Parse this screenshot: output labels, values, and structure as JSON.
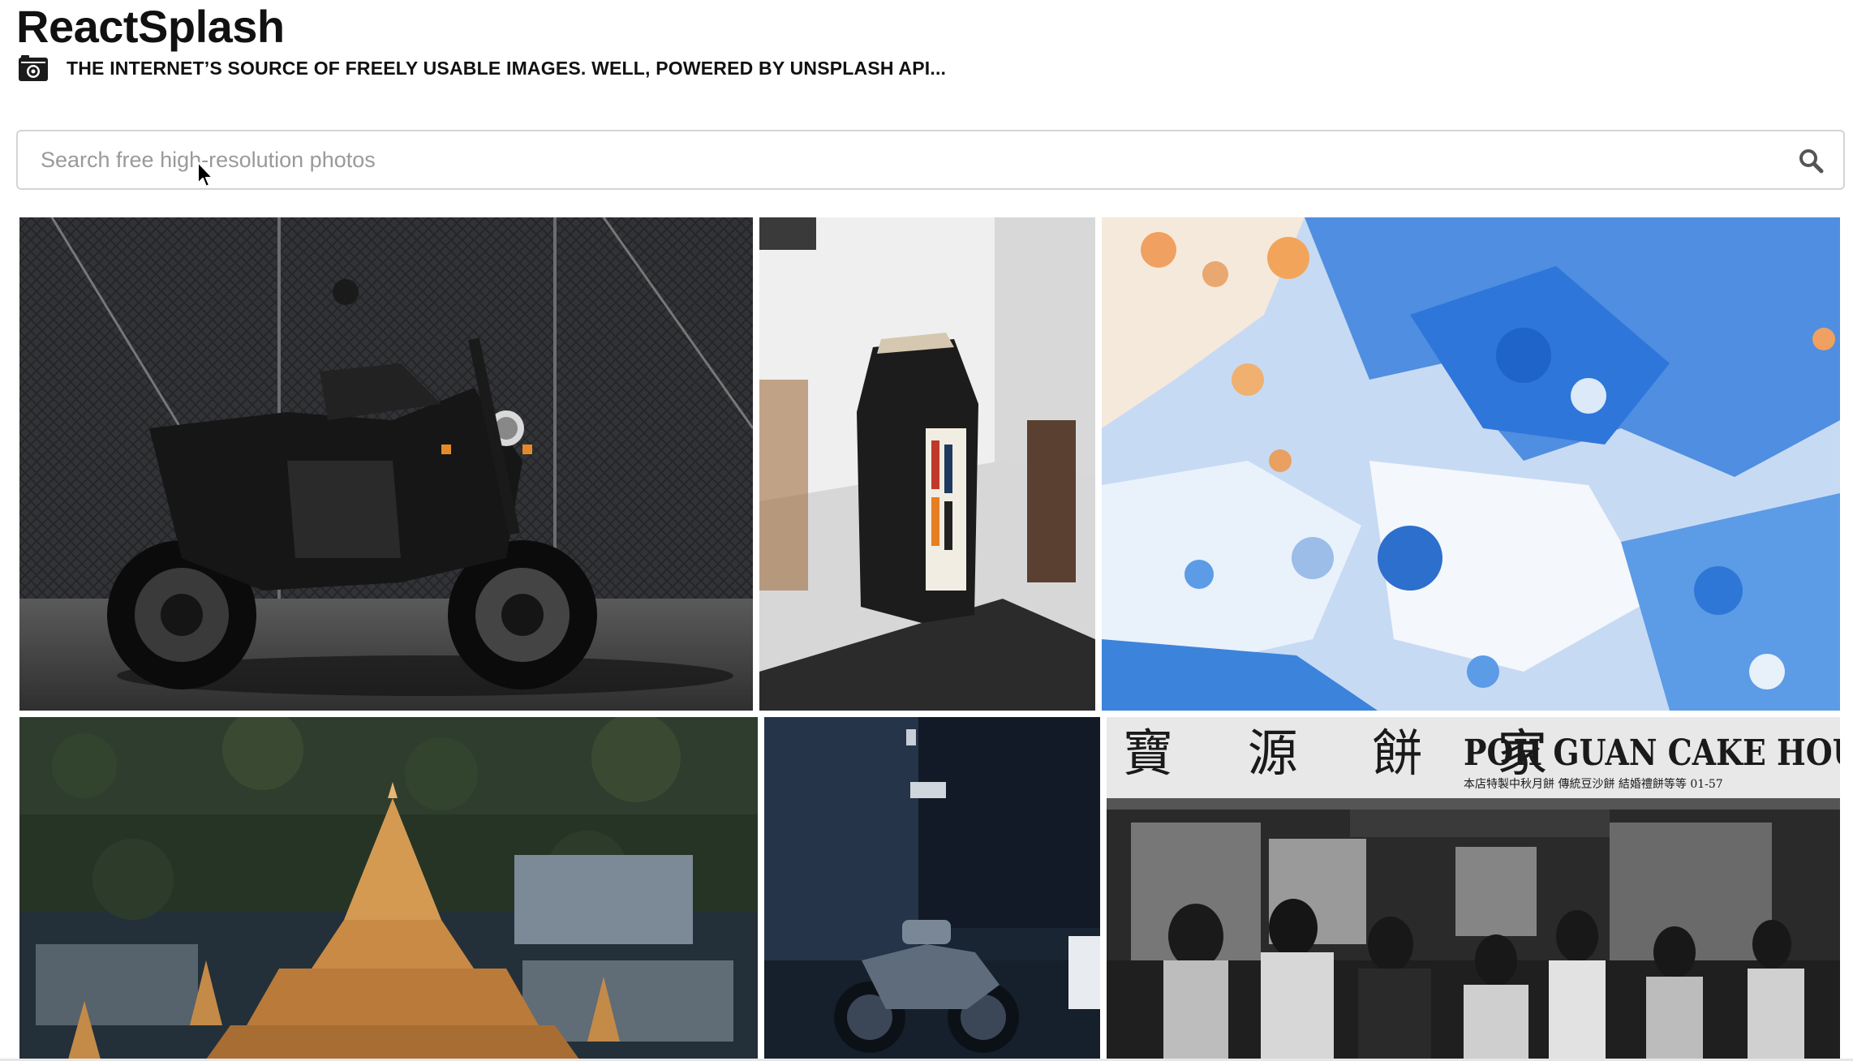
{
  "header": {
    "title": "ReactSplash",
    "subtitle": "THE INTERNET’S SOURCE OF FREELY USABLE IMAGES. WELL, POWERED BY UNSPLASH API...",
    "icon": "camera-icon"
  },
  "search": {
    "placeholder": "Search free high-resolution photos",
    "value": "",
    "icon": "search-icon"
  },
  "gallery": {
    "photos": [
      {
        "subject": "motorcycle"
      },
      {
        "subject": "coffee-bag"
      },
      {
        "subject": "abstract-paint"
      },
      {
        "subject": "golden-pagoda"
      },
      {
        "subject": "motorcycle-dark"
      },
      {
        "subject": "cake-house-storefront",
        "sign_chinese": "寶 源 餅 家",
        "sign_english": "POH GUAN CAKE HOUSE",
        "sign_small": "本店特製中秋月餅 傳統豆沙餅 結婚禮餅等等 01-57"
      }
    ]
  },
  "colors": {
    "text": "#111111",
    "border": "#d4d4d5",
    "placeholder": "#9a9a9a",
    "background": "#ffffff"
  }
}
